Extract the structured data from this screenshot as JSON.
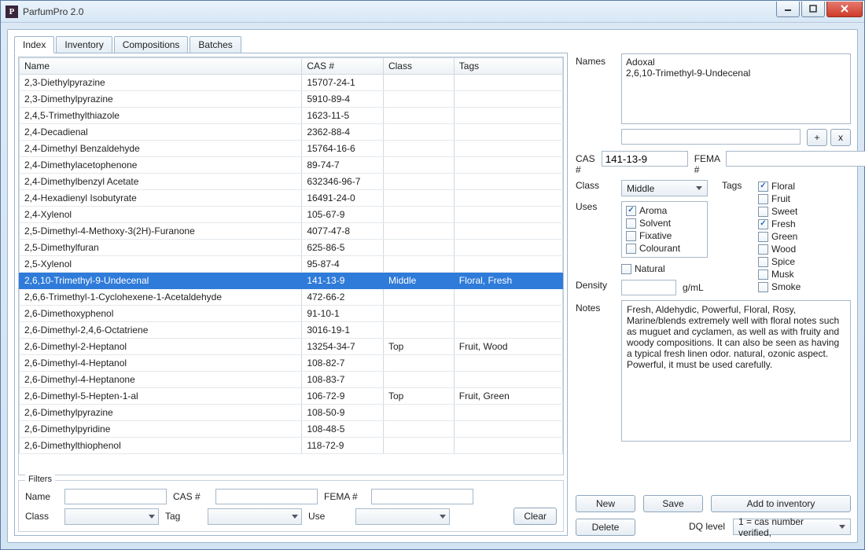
{
  "window": {
    "title": "ParfumPro 2.0",
    "icon_letter": "P"
  },
  "tabs": [
    "Index",
    "Inventory",
    "Compositions",
    "Batches"
  ],
  "active_tab": 0,
  "table": {
    "columns": [
      "Name",
      "CAS #",
      "Class",
      "Tags"
    ],
    "selected_index": 12,
    "rows": [
      {
        "name": "2,3-Diethylpyrazine",
        "cas": "15707-24-1",
        "class": "",
        "tags": ""
      },
      {
        "name": "2,3-Dimethylpyrazine",
        "cas": "5910-89-4",
        "class": "",
        "tags": ""
      },
      {
        "name": "2,4,5-Trimethylthiazole",
        "cas": "1623-11-5",
        "class": "",
        "tags": ""
      },
      {
        "name": "2,4-Decadienal",
        "cas": "2362-88-4",
        "class": "",
        "tags": ""
      },
      {
        "name": "2,4-Dimethyl Benzaldehyde",
        "cas": "15764-16-6",
        "class": "",
        "tags": ""
      },
      {
        "name": "2,4-Dimethylacetophenone",
        "cas": "89-74-7",
        "class": "",
        "tags": ""
      },
      {
        "name": "2,4-Dimethylbenzyl Acetate",
        "cas": "632346-96-7",
        "class": "",
        "tags": ""
      },
      {
        "name": "2,4-Hexadienyl Isobutyrate",
        "cas": "16491-24-0",
        "class": "",
        "tags": ""
      },
      {
        "name": "2,4-Xylenol",
        "cas": "105-67-9",
        "class": "",
        "tags": ""
      },
      {
        "name": "2,5-Dimethyl-4-Methoxy-3(2H)-Furanone",
        "cas": "4077-47-8",
        "class": "",
        "tags": ""
      },
      {
        "name": "2,5-Dimethylfuran",
        "cas": "625-86-5",
        "class": "",
        "tags": ""
      },
      {
        "name": "2,5-Xylenol",
        "cas": "95-87-4",
        "class": "",
        "tags": ""
      },
      {
        "name": "2,6,10-Trimethyl-9-Undecenal",
        "cas": "141-13-9",
        "class": "Middle",
        "tags": "Floral, Fresh"
      },
      {
        "name": "2,6,6-Trimethyl-1-Cyclohexene-1-Acetaldehyde",
        "cas": "472-66-2",
        "class": "",
        "tags": ""
      },
      {
        "name": "2,6-Dimethoxyphenol",
        "cas": "91-10-1",
        "class": "",
        "tags": ""
      },
      {
        "name": "2,6-Dimethyl-2,4,6-Octatriene",
        "cas": "3016-19-1",
        "class": "",
        "tags": ""
      },
      {
        "name": "2,6-Dimethyl-2-Heptanol",
        "cas": "13254-34-7",
        "class": "Top",
        "tags": "Fruit, Wood"
      },
      {
        "name": "2,6-Dimethyl-4-Heptanol",
        "cas": "108-82-7",
        "class": "",
        "tags": ""
      },
      {
        "name": "2,6-Dimethyl-4-Heptanone",
        "cas": "108-83-7",
        "class": "",
        "tags": ""
      },
      {
        "name": "2,6-Dimethyl-5-Hepten-1-al",
        "cas": "106-72-9",
        "class": "Top",
        "tags": "Fruit, Green"
      },
      {
        "name": "2,6-Dimethylpyrazine",
        "cas": "108-50-9",
        "class": "",
        "tags": ""
      },
      {
        "name": "2,6-Dimethylpyridine",
        "cas": "108-48-5",
        "class": "",
        "tags": ""
      },
      {
        "name": "2,6-Dimethylthiophenol",
        "cas": "118-72-9",
        "class": "",
        "tags": ""
      }
    ]
  },
  "filters": {
    "legend": "Filters",
    "labels": {
      "name": "Name",
      "cas": "CAS #",
      "fema": "FEMA #",
      "class": "Class",
      "tag": "Tag",
      "use": "Use"
    },
    "clear": "Clear",
    "values": {
      "name": "",
      "cas": "",
      "fema": "",
      "class": "",
      "tag": "",
      "use": ""
    }
  },
  "detail": {
    "labels": {
      "names": "Names",
      "cas": "CAS #",
      "fema": "FEMA #",
      "class": "Class",
      "tags": "Tags",
      "uses": "Uses",
      "natural": "Natural",
      "density": "Density",
      "density_unit": "g/mL",
      "notes": "Notes",
      "dq": "DQ level"
    },
    "names_text": "Adoxal\n2,6,10-Trimethyl-9-Undecenal",
    "name_add": "+",
    "name_remove": "x",
    "cas": "141-13-9",
    "fema": "",
    "class_value": "Middle",
    "uses": [
      {
        "label": "Aroma",
        "checked": true
      },
      {
        "label": "Solvent",
        "checked": false
      },
      {
        "label": "Fixative",
        "checked": false
      },
      {
        "label": "Colourant",
        "checked": false
      }
    ],
    "natural_checked": false,
    "tags": [
      {
        "label": "Floral",
        "checked": true
      },
      {
        "label": "Fruit",
        "checked": false
      },
      {
        "label": "Sweet",
        "checked": false
      },
      {
        "label": "Fresh",
        "checked": true
      },
      {
        "label": "Green",
        "checked": false
      },
      {
        "label": "Wood",
        "checked": false
      },
      {
        "label": "Spice",
        "checked": false
      },
      {
        "label": "Musk",
        "checked": false
      },
      {
        "label": "Smoke",
        "checked": false
      }
    ],
    "density": "",
    "notes": "Fresh, Aldehydic, Powerful, Floral, Rosy, Marine/blends extremely well with floral notes such as muguet and cyclamen, as well as with fruity and woody compositions. It can also be seen as having a typical fresh linen odor. natural, ozonic aspect. Powerful, it must be used carefully.",
    "buttons": {
      "new": "New",
      "save": "Save",
      "add_inv": "Add to inventory",
      "delete": "Delete"
    },
    "dq_value": "1 = cas number verified,"
  }
}
